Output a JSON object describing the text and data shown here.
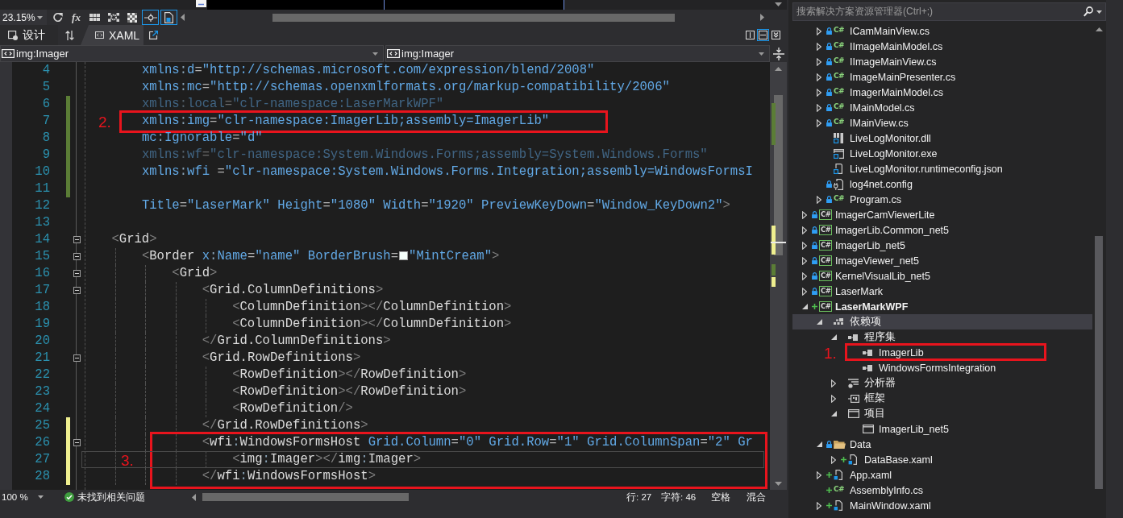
{
  "designer_toolbar": {
    "zoom": "23.15%",
    "buttons": [
      {
        "kind": "refresh",
        "on": false
      },
      {
        "kind": "formula",
        "label": "fx",
        "on": false
      },
      {
        "kind": "grid",
        "on": false
      },
      {
        "kind": "snap-grid",
        "on": false
      },
      {
        "kind": "checkerboard",
        "on": false
      },
      {
        "kind": "snap-lines",
        "on": true
      },
      {
        "kind": "annotations",
        "on": true
      }
    ]
  },
  "view_tabs": {
    "tabs": [
      {
        "kind": "design",
        "label": "设计",
        "selected": false
      },
      {
        "kind": "xaml",
        "label": "XAML",
        "selected": true
      }
    ],
    "pane_buttons": [
      {
        "kind": "vertical-split",
        "on": false
      },
      {
        "kind": "horizontal-split",
        "on": true
      },
      {
        "kind": "collapse",
        "on": false
      }
    ]
  },
  "nav_bar": {
    "combos": [
      {
        "value": "img:Imager"
      },
      {
        "value": "img:Imager"
      }
    ]
  },
  "editor": {
    "blocks": [
      {
        "kind": "plain",
        "lines": [
          {
            "number": "4",
            "text": "        xmlns:d=\"http://schemas.microsoft.com/expression/blend/2008\"",
            "dimmed": false,
            "current": false,
            "modified": false
          },
          {
            "number": "5",
            "text": "        xmlns:mc=\"http://schemas.openxmlformats.org/markup-compatibility/2006\"",
            "dimmed": false,
            "current": false,
            "modified": false
          },
          {
            "number": "6",
            "text": "        xmlns:local=\"clr-namespace:LaserMarkWPF\"",
            "dimmed": true,
            "current": false,
            "modified": true,
            "saved": true
          }
        ]
      },
      {
        "kind": "annotated",
        "label": "2.",
        "lines": [
          {
            "number": "7",
            "text": "        xmlns:img=\"clr-namespace:ImagerLib;assembly=ImagerLib\"",
            "dimmed": false,
            "current": false,
            "modified": true,
            "saved": true
          }
        ]
      },
      {
        "kind": "plain",
        "lines": [
          {
            "number": "8",
            "text": "        mc:Ignorable=\"d\"",
            "dimmed": false,
            "current": false,
            "modified": true,
            "saved": true
          },
          {
            "number": "9",
            "text": "        xmlns:wf=\"clr-namespace:System.Windows.Forms;assembly=System.Windows.Forms\"",
            "dimmed": true,
            "current": false,
            "modified": true,
            "saved": true
          },
          {
            "number": "10",
            "text": "        xmlns:wfi =\"clr-namespace:System.Windows.Forms.Integration;assembly=WindowsFormsI",
            "dimmed": false,
            "current": false,
            "modified": true,
            "saved": true
          },
          {
            "number": "11",
            "current": false,
            "modified": true,
            "saved": true
          },
          {
            "number": "12",
            "text": "        Title=\"LaserMark\" Height=\"1080\" Width=\"1920\" PreviewKeyDown=\"Window_KeyDown2\">",
            "dimmed": false,
            "current": false,
            "modified": false
          },
          {
            "number": "13",
            "current": false,
            "modified": false
          },
          {
            "number": "14",
            "text": "    <Grid>",
            "dimmed": false,
            "current": false,
            "modified": false,
            "expanded": true
          },
          {
            "number": "15",
            "text": "        <Border x:Name=\"name\" BorderBrush=",
            "swatch": true,
            "text_after": "\"MintCream\">",
            "dimmed": false,
            "current": false,
            "modified": false,
            "expanded": true
          },
          {
            "number": "16",
            "text": "            <Grid>",
            "dimmed": false,
            "current": false,
            "modified": false,
            "expanded": true
          },
          {
            "number": "17",
            "text": "                <Grid.ColumnDefinitions>",
            "dimmed": false,
            "current": false,
            "modified": false,
            "expanded": true
          },
          {
            "number": "18",
            "text": "                    <ColumnDefinition></ColumnDefinition>",
            "dimmed": false,
            "current": false,
            "modified": false
          },
          {
            "number": "19",
            "text": "                    <ColumnDefinition></ColumnDefinition>",
            "dimmed": false,
            "current": false,
            "modified": false
          },
          {
            "number": "20",
            "text": "                </Grid.ColumnDefinitions>",
            "dimmed": false,
            "current": false,
            "modified": false
          },
          {
            "number": "21",
            "text": "                <Grid.RowDefinitions>",
            "dimmed": false,
            "current": false,
            "modified": false,
            "expanded": true
          },
          {
            "number": "22",
            "text": "                    <RowDefinition></RowDefinition>",
            "dimmed": false,
            "current": false,
            "modified": false
          },
          {
            "number": "23",
            "text": "                    <RowDefinition></RowDefinition>",
            "dimmed": false,
            "current": false,
            "modified": false
          },
          {
            "number": "24",
            "text": "                    <RowDefinition/>",
            "dimmed": false,
            "current": false,
            "modified": false
          },
          {
            "number": "25",
            "text": "                </Grid.RowDefinitions>",
            "dimmed": false,
            "current": false,
            "modified": true,
            "saved": false
          }
        ]
      },
      {
        "kind": "annotated",
        "label": "3.",
        "lines": [
          {
            "number": "26",
            "text": "                <wfi:WindowsFormsHost Grid.Column=\"0\" Grid.Row=\"1\" Grid.ColumnSpan=\"2\" Gr",
            "dimmed": false,
            "current": false,
            "modified": true,
            "saved": false,
            "expanded": true
          },
          {
            "number": "27",
            "text": "                    <img:Imager></img:Imager>",
            "dimmed": false,
            "current": true,
            "modified": true,
            "saved": false
          },
          {
            "number": "28",
            "text": "                </wfi:WindowsFormsHost>",
            "dimmed": false,
            "current": false,
            "modified": true,
            "saved": false
          }
        ]
      }
    ]
  },
  "status_bar": {
    "zoom": "100 %",
    "issues": "未找到相关问题",
    "line": "行: 27",
    "column": "字符: 46",
    "indent": "空格",
    "line_endings": "混合"
  },
  "solution_explorer": {
    "search": {
      "placeholder": "搜索解决方案资源管理器(Ctrl+;)"
    },
    "tree": [
      {
        "kind": "offscreen-parent",
        "children": [
          {
            "kind": "cs",
            "icon_text": "C#",
            "label": "ICamMainView.cs",
            "locked": true,
            "added": false,
            "expanded": false,
            "selected": false
          },
          {
            "kind": "cs",
            "icon_text": "C#",
            "label": "IImageMainModel.cs",
            "locked": true,
            "added": false,
            "expanded": false,
            "selected": false
          },
          {
            "kind": "cs",
            "icon_text": "C#",
            "label": "IImageMainView.cs",
            "locked": true,
            "added": false,
            "expanded": false,
            "selected": false
          },
          {
            "kind": "cs",
            "icon_text": "C#",
            "label": "ImageMainPresenter.cs",
            "locked": true,
            "added": false,
            "expanded": false,
            "selected": false
          },
          {
            "kind": "cs",
            "icon_text": "C#",
            "label": "ImagerMainModel.cs",
            "locked": true,
            "added": false,
            "expanded": false,
            "selected": false
          },
          {
            "kind": "cs",
            "icon_text": "C#",
            "label": "IMainModel.cs",
            "locked": true,
            "added": false,
            "expanded": false,
            "selected": false
          },
          {
            "kind": "cs",
            "icon_text": "C#",
            "label": "IMainView.cs",
            "locked": true,
            "added": false,
            "expanded": false,
            "selected": false
          },
          {
            "kind": "dll",
            "label": "LiveLogMonitor.dll",
            "locked": false,
            "added": false,
            "selected": false
          },
          {
            "kind": "exe",
            "label": "LiveLogMonitor.exe",
            "locked": false,
            "added": false,
            "selected": false
          },
          {
            "kind": "json",
            "label": "LiveLogMonitor.runtimeconfig.json",
            "locked": false,
            "added": false,
            "selected": false
          },
          {
            "kind": "config",
            "label": "log4net.config",
            "locked": true,
            "added": false,
            "selected": false
          },
          {
            "kind": "cs",
            "icon_text": "C#",
            "label": "Program.cs",
            "locked": true,
            "added": false,
            "expanded": false,
            "selected": false
          }
        ]
      },
      {
        "kind": "project",
        "icon_text": "C#",
        "label": "ImagerCamViewerLite",
        "locked": true,
        "added": false,
        "expanded": false,
        "startup": false,
        "selected": false
      },
      {
        "kind": "project",
        "icon_text": "C#",
        "label": "ImagerLib.Common_net5",
        "locked": true,
        "added": false,
        "expanded": false,
        "startup": false,
        "selected": false
      },
      {
        "kind": "project",
        "icon_text": "C#",
        "label": "ImagerLib_net5",
        "locked": true,
        "added": false,
        "expanded": false,
        "startup": false,
        "selected": false
      },
      {
        "kind": "project",
        "icon_text": "C#",
        "label": "ImageViewer_net5",
        "locked": true,
        "added": false,
        "expanded": false,
        "startup": false,
        "selected": false
      },
      {
        "kind": "project",
        "icon_text": "C#",
        "label": "KernelVisualLib_net5",
        "locked": true,
        "added": false,
        "expanded": false,
        "startup": false,
        "selected": false
      },
      {
        "kind": "project",
        "icon_text": "C#",
        "label": "LaserMark",
        "locked": true,
        "added": false,
        "expanded": false,
        "startup": false,
        "selected": false
      },
      {
        "kind": "project",
        "icon_text": "C#",
        "label": "LaserMarkWPF",
        "locked": false,
        "added": true,
        "expanded": true,
        "startup": true,
        "selected": false,
        "children": [
          {
            "kind": "dependencies",
            "label": "依赖项",
            "locked": false,
            "added": false,
            "expanded": true,
            "selected": true,
            "children": [
              {
                "kind": "assemblies",
                "label": "程序集",
                "locked": false,
                "added": false,
                "expanded": true,
                "selected": false,
                "children": [
                  {
                    "kind": "reference",
                    "label": "ImagerLib",
                    "locked": false,
                    "added": false,
                    "selected": false,
                    "annotation": "1."
                  },
                  {
                    "kind": "reference",
                    "label": "WindowsFormsIntegration",
                    "locked": false,
                    "added": false,
                    "selected": false
                  }
                ]
              },
              {
                "kind": "analyzers",
                "label": "分析器",
                "locked": false,
                "added": false,
                "expanded": false,
                "selected": false
              },
              {
                "kind": "frameworks",
                "label": "框架",
                "locked": false,
                "added": false,
                "expanded": false,
                "selected": false
              },
              {
                "kind": "projects",
                "label": "项目",
                "locked": false,
                "added": false,
                "expanded": true,
                "selected": false,
                "children": [
                  {
                    "kind": "project-ref",
                    "label": "ImagerLib_net5",
                    "locked": false,
                    "added": false,
                    "selected": false
                  }
                ]
              }
            ]
          },
          {
            "kind": "folder",
            "label": "Data",
            "locked": true,
            "added": false,
            "expanded": true,
            "selected": false,
            "children": [
              {
                "kind": "xaml",
                "label": "DataBase.xaml",
                "locked": false,
                "added": true,
                "expanded": false,
                "selected": false
              }
            ]
          },
          {
            "kind": "xaml",
            "label": "App.xaml",
            "locked": false,
            "added": true,
            "expanded": false,
            "selected": false
          },
          {
            "kind": "cs",
            "icon_text": "C#",
            "label": "AssemblyInfo.cs",
            "locked": false,
            "added": true,
            "selected": false
          },
          {
            "kind": "xaml",
            "label": "MainWindow.xaml",
            "locked": false,
            "added": true,
            "expanded": false,
            "selected": false
          }
        ]
      }
    ]
  }
}
